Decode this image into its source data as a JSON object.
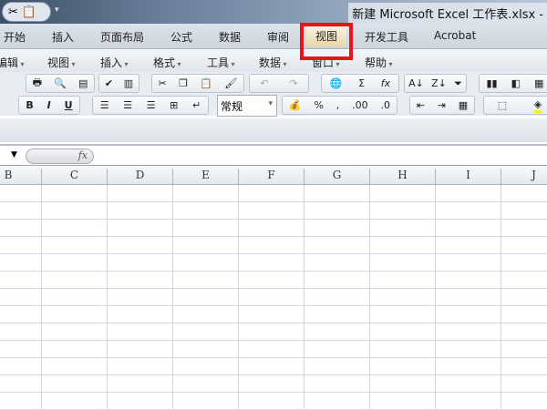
{
  "title_bar": {
    "title": "新建 Microsoft Excel 工作表.xlsx -"
  },
  "ribbon_tabs": [
    "开始",
    "插入",
    "页面布局",
    "公式",
    "数据",
    "审阅",
    "视图",
    "开发工具",
    "Acrobat"
  ],
  "active_tab": "视图",
  "menu": [
    "编辑",
    "视图",
    "插入",
    "格式",
    "工具",
    "数据",
    "窗口",
    "帮助"
  ],
  "toolbar": {
    "bold": "B",
    "italic": "I",
    "underline": "U",
    "sum": "Σ",
    "fx": "fx",
    "percent": "%",
    "comma": ",",
    "inc_decimal": ".00",
    "dec_decimal": ".0",
    "number_format": "常规"
  },
  "formula_bar": {
    "fx_label": "fx",
    "value": ""
  },
  "columns": [
    "B",
    "C",
    "D",
    "E",
    "F",
    "G",
    "H",
    "I",
    "J"
  ],
  "highlight_color": "#e8141c"
}
